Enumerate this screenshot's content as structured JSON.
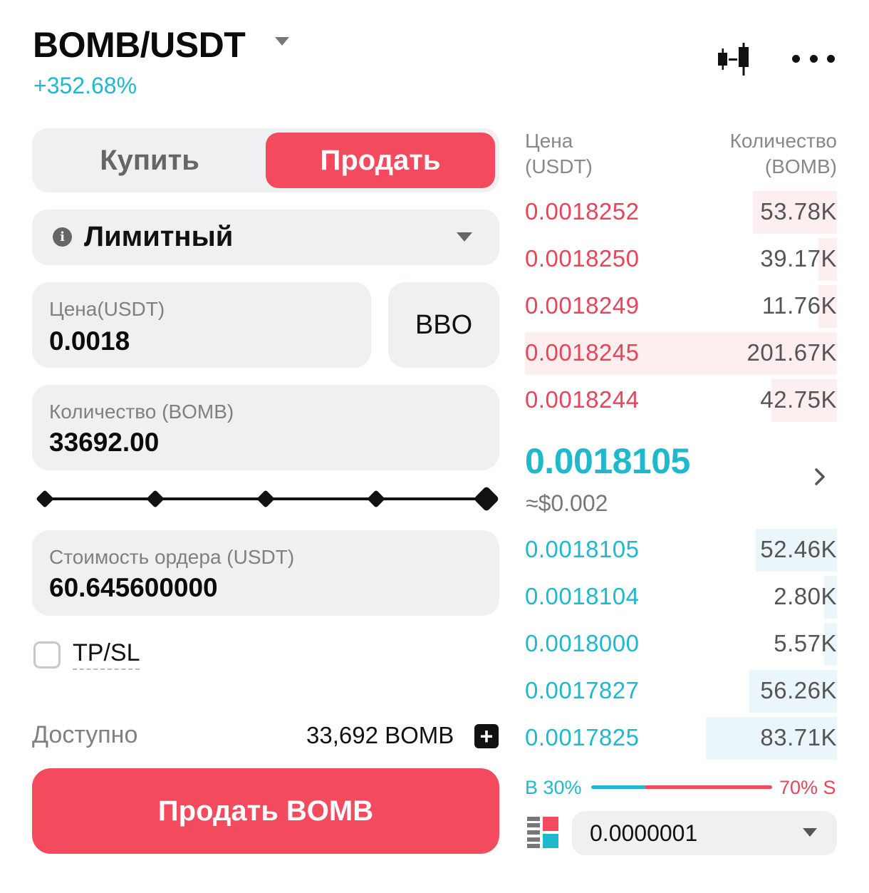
{
  "header": {
    "pair": "BOMB/USDT",
    "change": "+352.68%"
  },
  "tabs": [
    {
      "label": "Купить",
      "active": false
    },
    {
      "label": "Продать",
      "active": true
    }
  ],
  "order_type": {
    "label": "Лимитный",
    "info_icon": "i"
  },
  "price_field": {
    "label": "Цена(USDT)",
    "value": "0.0018"
  },
  "bbo_button": "BBO",
  "quantity_field": {
    "label": "Количество (BOMB)",
    "value": "33692.00"
  },
  "slider": {
    "value_percent": 100,
    "marks": [
      0,
      25,
      50,
      75,
      100
    ]
  },
  "cost_field": {
    "label": "Стоимость ордера (USDT)",
    "value": "60.645600000"
  },
  "tpsl": {
    "label": "TP/SL",
    "checked": false
  },
  "available": {
    "label": "Доступно",
    "value": "33,692 BOMB",
    "plus_icon": "+"
  },
  "submit_button": "Продать BOMB",
  "orderbook": {
    "header_price": [
      "Цена",
      "(USDT)"
    ],
    "header_qty": [
      "Количество",
      "(BOMB)"
    ],
    "asks": [
      {
        "price": "0.0018252",
        "qty": "53.78K",
        "depth": 0.27
      },
      {
        "price": "0.0018250",
        "qty": "39.17K",
        "depth": 0.06
      },
      {
        "price": "0.0018249",
        "qty": "11.76K",
        "depth": 0.06
      },
      {
        "price": "0.0018245",
        "qty": "201.67K",
        "depth": 1.0
      },
      {
        "price": "0.0018244",
        "qty": "42.75K",
        "depth": 0.21
      }
    ],
    "last_price": "0.0018105",
    "last_price_usd": "≈$0.002",
    "bids": [
      {
        "price": "0.0018105",
        "qty": "52.46K",
        "depth": 0.26
      },
      {
        "price": "0.0018104",
        "qty": "2.80K",
        "depth": 0.04
      },
      {
        "price": "0.0018000",
        "qty": "5.57K",
        "depth": 0.04
      },
      {
        "price": "0.0017827",
        "qty": "56.26K",
        "depth": 0.28
      },
      {
        "price": "0.0017825",
        "qty": "83.71K",
        "depth": 0.42
      }
    ],
    "ratio": {
      "buy_label": "B 30%",
      "sell_label": "70% S",
      "buy_percent": 30,
      "sell_percent": 70
    },
    "step": "0.0000001"
  },
  "colors": {
    "sell": "#f44a5e",
    "buy": "#20b8cd",
    "field_bg": "#eff0f2"
  }
}
